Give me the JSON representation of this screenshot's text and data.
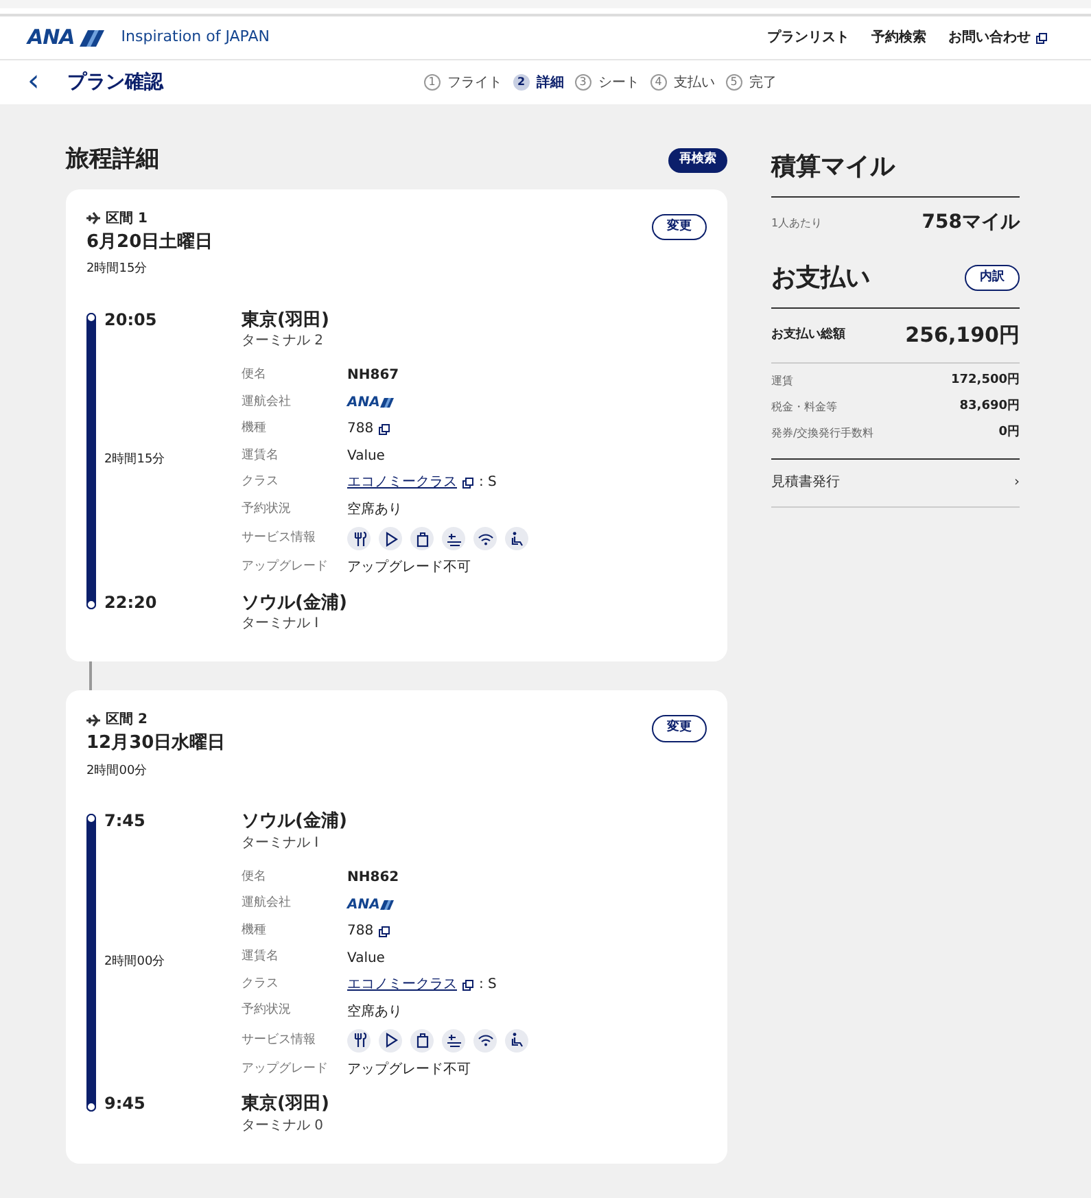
{
  "header": {
    "logo": "ANA",
    "tagline": "Inspiration of JAPAN",
    "links": [
      {
        "kind": "plain",
        "label": "プランリスト"
      },
      {
        "kind": "plain",
        "label": "予約検索"
      },
      {
        "kind": "external",
        "label": "お問い合わせ"
      }
    ]
  },
  "subheader": {
    "back": "‹",
    "title": "プラン確認",
    "steps": [
      {
        "number": "1",
        "label": "フライト",
        "selected": false
      },
      {
        "number": "2",
        "label": "詳細",
        "selected": true
      },
      {
        "number": "3",
        "label": "シート",
        "selected": false
      },
      {
        "number": "4",
        "label": "支払い",
        "selected": false
      },
      {
        "number": "5",
        "label": "完了",
        "selected": false
      }
    ]
  },
  "itinerary": {
    "title": "旅程詳細",
    "research_button": "再検索",
    "segments": [
      {
        "label": "区間 1",
        "change_button": "変更",
        "date": "6月20日土曜日",
        "duration": "2時間15分",
        "departure": {
          "time": "20:05",
          "airport": "東京(羽田)",
          "terminal": "ターミナル 2"
        },
        "flight_duration": "2時間15分",
        "details": [
          {
            "kind": "bold",
            "label": "便名",
            "value": "NH867"
          },
          {
            "kind": "logo",
            "label": "運航会社",
            "value": "ANA"
          },
          {
            "kind": "popup",
            "label": "機種",
            "value": "788"
          },
          {
            "kind": "text",
            "label": "運賃名",
            "value": "Value"
          },
          {
            "kind": "class",
            "label": "クラス",
            "value": "エコノミークラス",
            "suffix": ": S"
          },
          {
            "kind": "text",
            "label": "予約状況",
            "value": "空席あり"
          },
          {
            "kind": "services",
            "label": "サービス情報",
            "services": [
              {
                "kind": "meal"
              },
              {
                "kind": "video"
              },
              {
                "kind": "bag"
              },
              {
                "kind": "power"
              },
              {
                "kind": "wifi"
              },
              {
                "kind": "seat"
              }
            ]
          },
          {
            "kind": "text",
            "label": "アップグレード",
            "value": "アップグレード不可"
          }
        ],
        "arrival": {
          "time": "22:20",
          "airport": "ソウル(金浦)",
          "terminal": "ターミナル I"
        }
      },
      {
        "label": "区間 2",
        "change_button": "変更",
        "date": "12月30日水曜日",
        "duration": "2時間00分",
        "departure": {
          "time": "7:45",
          "airport": "ソウル(金浦)",
          "terminal": "ターミナル I"
        },
        "flight_duration": "2時間00分",
        "details": [
          {
            "kind": "bold",
            "label": "便名",
            "value": "NH862"
          },
          {
            "kind": "logo",
            "label": "運航会社",
            "value": "ANA"
          },
          {
            "kind": "popup",
            "label": "機種",
            "value": "788"
          },
          {
            "kind": "text",
            "label": "運賃名",
            "value": "Value"
          },
          {
            "kind": "class",
            "label": "クラス",
            "value": "エコノミークラス",
            "suffix": ": S"
          },
          {
            "kind": "text",
            "label": "予約状況",
            "value": "空席あり"
          },
          {
            "kind": "services",
            "label": "サービス情報",
            "services": [
              {
                "kind": "meal"
              },
              {
                "kind": "video"
              },
              {
                "kind": "bag"
              },
              {
                "kind": "power"
              },
              {
                "kind": "wifi"
              },
              {
                "kind": "seat"
              }
            ]
          },
          {
            "kind": "text",
            "label": "アップグレード",
            "value": "アップグレード不可"
          }
        ],
        "arrival": {
          "time": "9:45",
          "airport": "東京(羽田)",
          "terminal": "ターミナル 0"
        }
      }
    ]
  },
  "miles": {
    "title": "積算マイル",
    "per_person_label": "1人あたり",
    "per_person_value": "758マイル"
  },
  "payment": {
    "title": "お支払い",
    "breakdown_button": "内訳",
    "total_label": "お支払い総額",
    "total_value": "256,190円",
    "rows": [
      {
        "label": "運賃",
        "value": "172,500円"
      },
      {
        "label": "税金・料金等",
        "value": "83,690円"
      },
      {
        "label": "発券/交換発行手数料",
        "value": "0円"
      }
    ],
    "quote_link": "見積書発行",
    "quote_chevron": "›"
  }
}
